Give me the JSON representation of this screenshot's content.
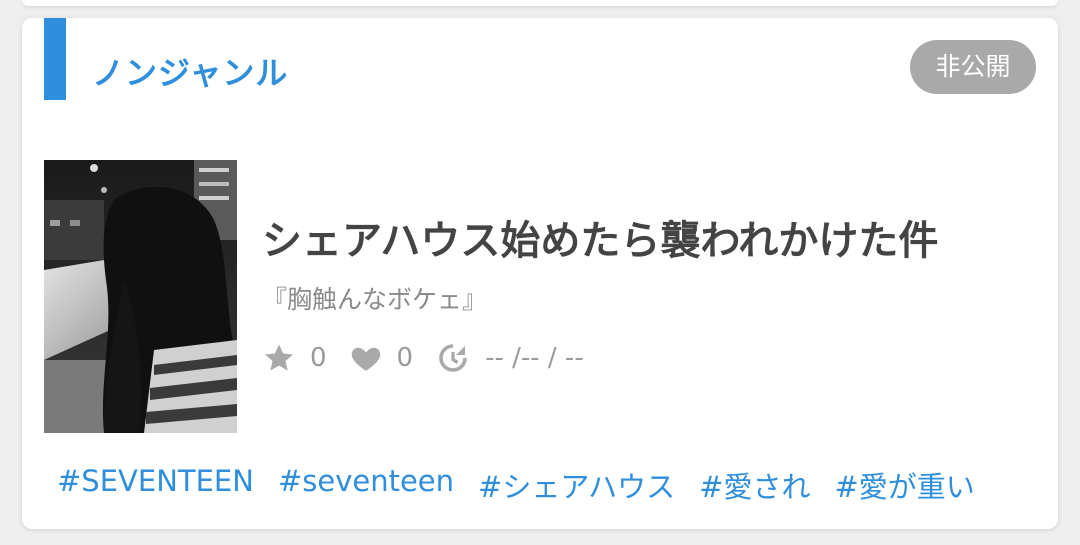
{
  "card": {
    "genre": "ノンジャンル",
    "visibility_badge": "非公開",
    "title": "シェアハウス始めたら襲われかけた件",
    "author": "『胸触んなボケェ』",
    "stats": {
      "star_count": "0",
      "heart_count": "0",
      "updated": "-- /-- / --"
    },
    "tags": [
      "#SEVENTEEN",
      "#seventeen",
      "#シェアハウス",
      "#愛され",
      "#愛が重い"
    ]
  },
  "colors": {
    "accent": "#2f8fdc",
    "badge_bg": "#a9a9a9",
    "title": "#444444",
    "muted": "#9a9a9a"
  },
  "icons": {
    "star": "star-icon",
    "heart": "heart-icon",
    "history": "history-icon"
  }
}
